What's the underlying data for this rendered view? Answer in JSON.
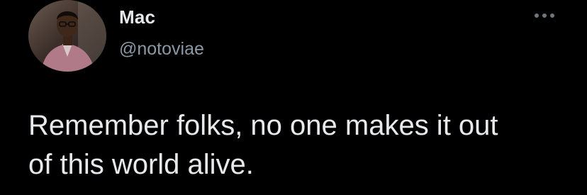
{
  "tweet": {
    "author": {
      "display_name": "Mac",
      "handle": "@notoviae",
      "avatar_icon": "profile-photo"
    },
    "more_icon": "more-horizontal-icon",
    "text": "Remember folks, no one makes it out\nof this world alive."
  },
  "colors": {
    "background": "#000000",
    "primary_text": "#e7e9ea",
    "secondary_text": "#8b98a5"
  }
}
